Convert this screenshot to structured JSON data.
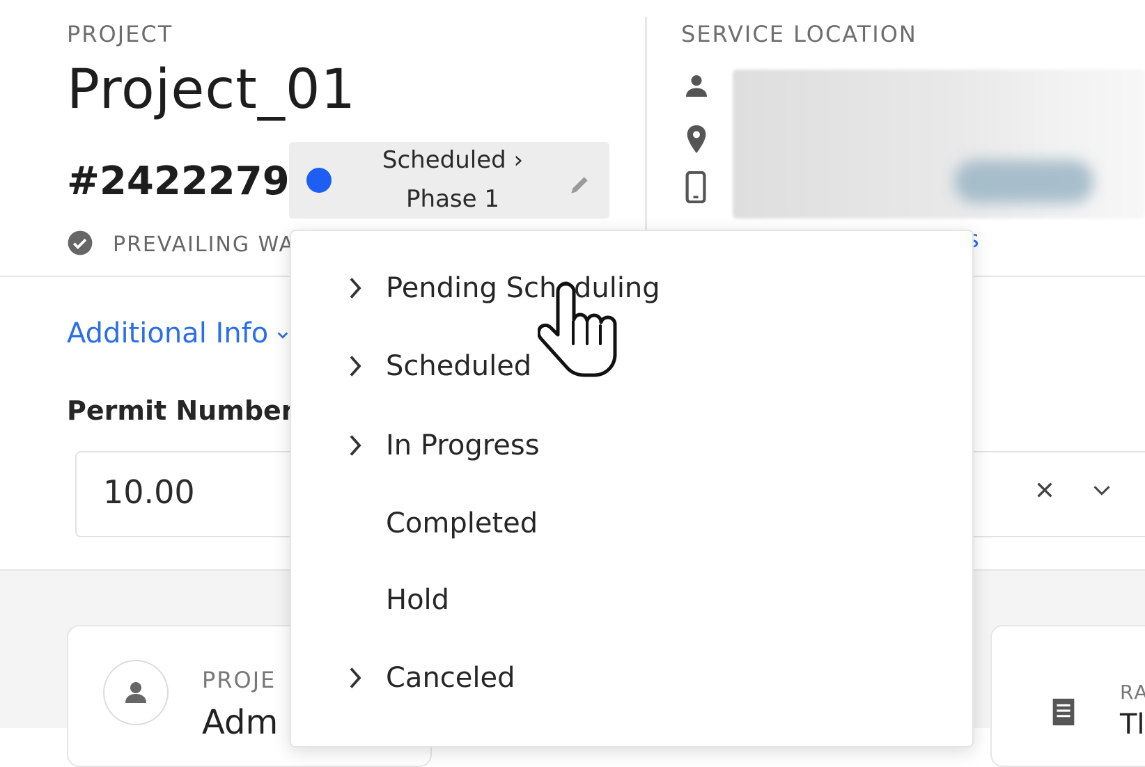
{
  "project": {
    "eyebrow": "PROJECT",
    "title": "Project_01",
    "number": "#2422279",
    "prevailing_wage": "PREVAILING WA"
  },
  "status": {
    "line1": "Scheduled ›",
    "line2": "Phase 1",
    "dot_color": "#1d5ff2"
  },
  "service_location": {
    "eyebrow": "SERVICE LOCATION",
    "link_tail": "s"
  },
  "additional_info": {
    "label": "Additional Info"
  },
  "permit": {
    "label": "Permit Number",
    "value": "10.00"
  },
  "status_menu": {
    "items": [
      {
        "label": "Pending Scheduling",
        "has_submenu": true
      },
      {
        "label": "Scheduled",
        "has_submenu": true
      },
      {
        "label": "In Progress",
        "has_submenu": true
      },
      {
        "label": "Completed",
        "has_submenu": false
      },
      {
        "label": "Hold",
        "has_submenu": false
      },
      {
        "label": "Canceled",
        "has_submenu": true
      }
    ]
  },
  "cards": {
    "left_eyebrow": "PROJE",
    "left_main": "Adm",
    "right_eyebrow": "RA",
    "right_main": "Tl"
  },
  "colors": {
    "accent_link": "#2b6ee8"
  }
}
